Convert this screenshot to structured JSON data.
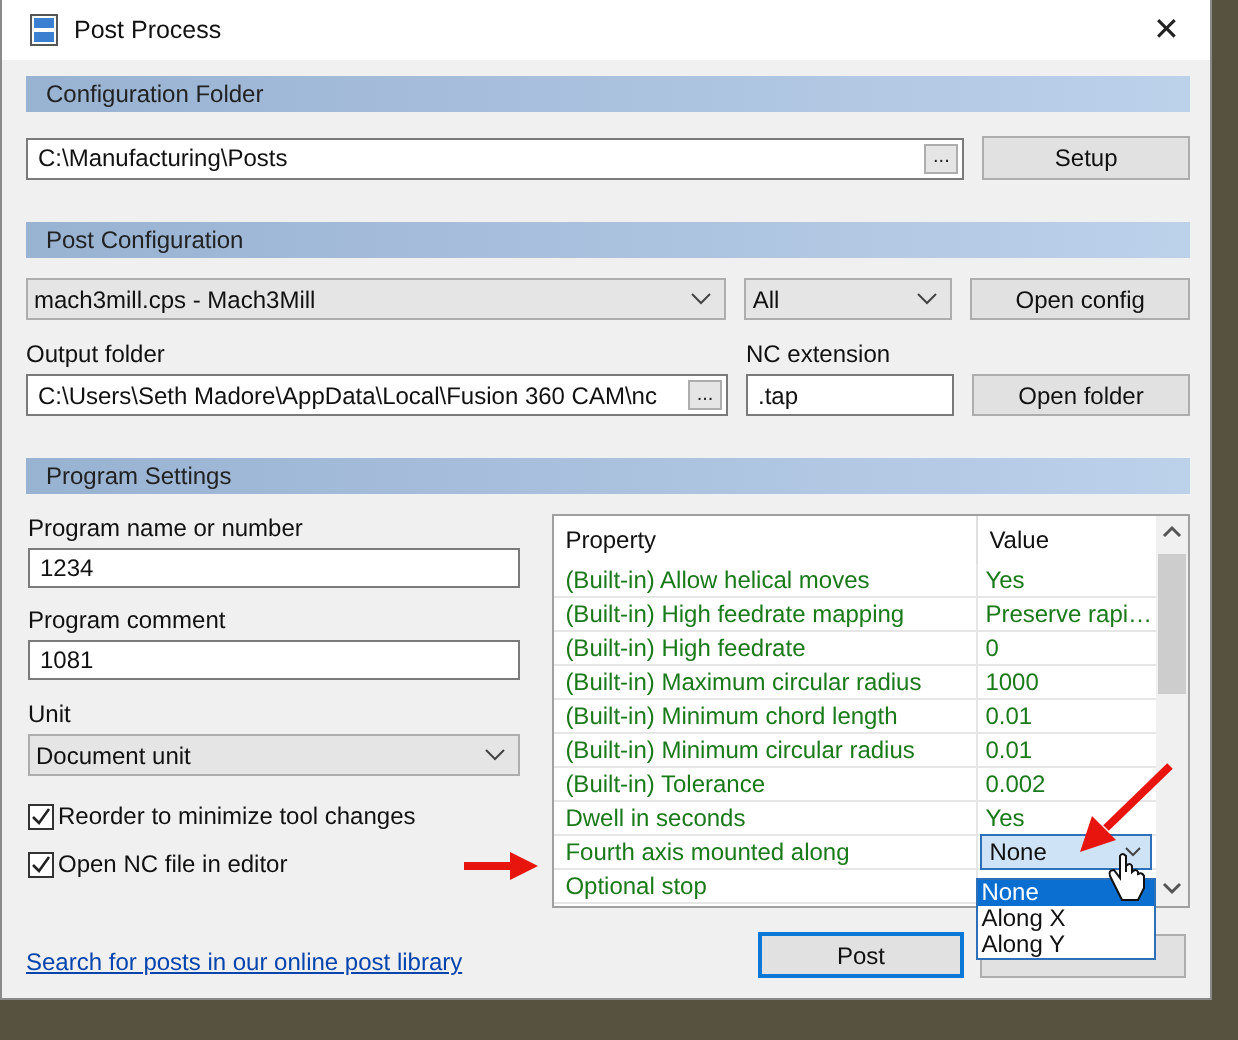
{
  "window": {
    "title": "Post Process",
    "close_glyph": "✕"
  },
  "configuration_folder": {
    "header": "Configuration Folder",
    "path": "C:\\Manufacturing\\Posts",
    "browse": "...",
    "setup_button": "Setup"
  },
  "post_configuration": {
    "header": "Post Configuration",
    "post": "mach3mill.cps - Mach3Mill",
    "filter": "All",
    "open_config_button": "Open config",
    "output_folder_label": "Output folder",
    "output_folder": "C:\\Users\\Seth Madore\\AppData\\Local\\Fusion 360 CAM\\nc",
    "browse": "...",
    "nc_extension_label": "NC extension",
    "nc_extension": ".tap",
    "open_folder_button": "Open folder"
  },
  "program_settings": {
    "header": "Program Settings",
    "program_name_label": "Program name or number",
    "program_name": "1234",
    "program_comment_label": "Program comment",
    "program_comment": "1081",
    "unit_label": "Unit",
    "unit": "Document unit",
    "checkboxes": [
      {
        "label": "Reorder to minimize tool changes",
        "checked": true
      },
      {
        "label": "Open NC file in editor",
        "checked": true
      }
    ],
    "link": "Search for posts in our online post library",
    "property_table": {
      "columns": [
        "Property",
        "Value"
      ],
      "rows": [
        {
          "property": "(Built-in) Allow helical moves",
          "value": "Yes"
        },
        {
          "property": "(Built-in) High feedrate mapping",
          "value": "Preserve rapi…"
        },
        {
          "property": "(Built-in) High feedrate",
          "value": "0"
        },
        {
          "property": "(Built-in) Maximum circular radius",
          "value": "1000"
        },
        {
          "property": "(Built-in) Minimum chord length",
          "value": "0.01"
        },
        {
          "property": "(Built-in) Minimum circular radius",
          "value": "0.01"
        },
        {
          "property": "(Built-in) Tolerance",
          "value": "0.002"
        },
        {
          "property": "Dwell in seconds",
          "value": "Yes"
        },
        {
          "property": "Fourth axis mounted along",
          "value": "None",
          "kind": "dropdown"
        },
        {
          "property": "Optional stop",
          "value": ""
        }
      ]
    },
    "dropdown": {
      "options": [
        {
          "label": "None",
          "selected": true
        },
        {
          "label": "Along X",
          "selected": false
        },
        {
          "label": "Along Y",
          "selected": false
        }
      ]
    }
  },
  "buttons": {
    "post": "Post"
  }
}
